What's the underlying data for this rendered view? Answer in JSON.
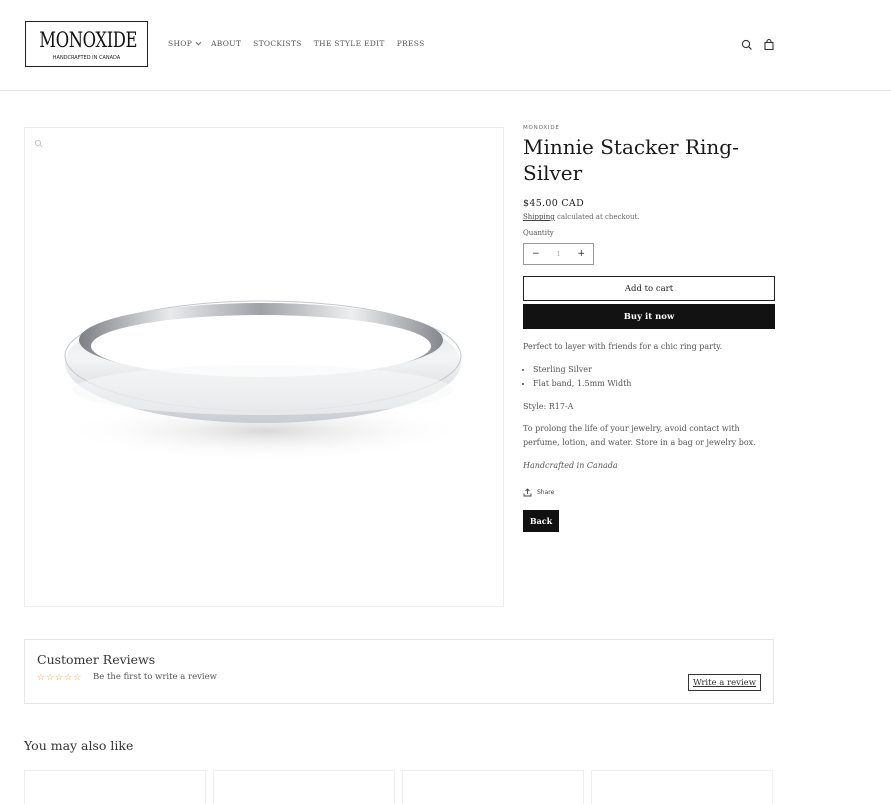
{
  "header": {
    "logo_name": "MONOXIDE",
    "logo_tagline": "HANDCRAFTED IN CANADA",
    "nav": [
      "SHOP",
      "ABOUT",
      "STOCKISTS",
      "THE STYLE EDIT",
      "PRESS"
    ]
  },
  "product": {
    "vendor": "MONOXIDE",
    "title": "Minnie Stacker Ring-Silver",
    "price": "$45.00 CAD",
    "shipping_link": "Shipping",
    "shipping_rest": " calculated at checkout.",
    "quantity_label": "Quantity",
    "quantity_value": "1",
    "decrement": "−",
    "increment": "+",
    "add_to_cart": "Add to cart",
    "buy_now": "Buy it now",
    "description": "Perfect to layer with friends for a chic ring party.",
    "bullets": [
      "Sterling Silver",
      "Flat band, 1.5mm Width"
    ],
    "style": "Style: R17-A",
    "care": "To prolong the life of your jewelry, avoid contact with perfume, lotion, and water. Store in a bag or jewelry box.",
    "origin": "Handcrafted in Canada",
    "share": "Share",
    "back": "Back"
  },
  "reviews": {
    "title": "Customer Reviews",
    "rating": 0,
    "max_rating": 5,
    "empty_text": "Be the first to write a review",
    "write_button": "Write a review",
    "star_color": "#e8a629"
  },
  "related": {
    "title": "You may also like"
  }
}
